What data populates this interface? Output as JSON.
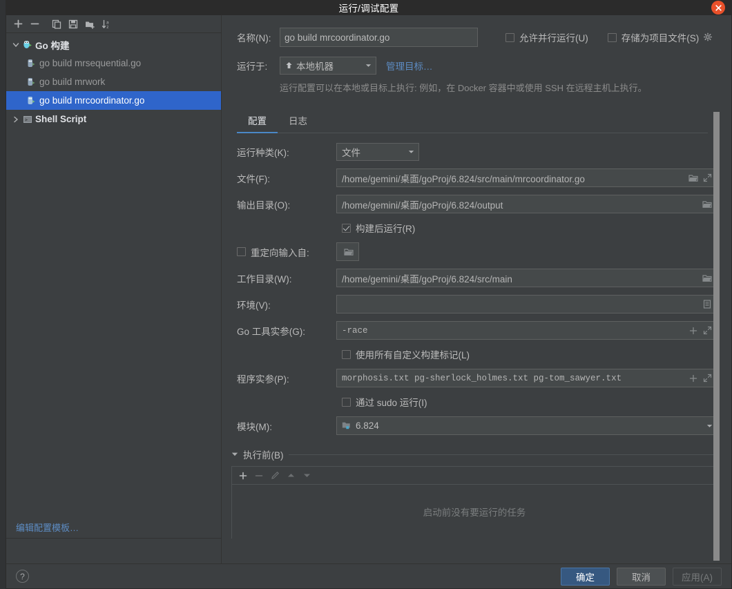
{
  "dialog": {
    "title": "运行/调试配置",
    "close_icon": "close-icon"
  },
  "tree_toolbar": {
    "buttons": [
      {
        "name": "add-configuration",
        "icon": "plus-icon"
      },
      {
        "name": "remove-configuration",
        "icon": "minus-icon"
      },
      {
        "name": "copy-configuration",
        "icon": "copy-icon"
      },
      {
        "name": "save-configuration",
        "icon": "save-icon"
      },
      {
        "name": "move-into-folder",
        "icon": "new-folder-icon"
      },
      {
        "name": "sort-configurations",
        "icon": "sort-alpha-icon"
      }
    ]
  },
  "tree": {
    "items": [
      {
        "label": "Go 构建",
        "type": "group",
        "expanded": true,
        "selected": false,
        "icon": "go-gopher-icon"
      },
      {
        "label": "go build mrsequential.go",
        "type": "child",
        "selected": false,
        "icon": "go-run-icon"
      },
      {
        "label": "go build mrwork",
        "type": "child",
        "selected": false,
        "icon": "go-run-icon"
      },
      {
        "label": "go build mrcoordinator.go",
        "type": "child",
        "selected": true,
        "icon": "go-run-icon"
      },
      {
        "label": "Shell Script",
        "type": "group",
        "expanded": false,
        "selected": false,
        "icon": "shell-script-icon"
      }
    ],
    "edit_templates_link": "编辑配置模板…"
  },
  "header": {
    "name_label": "名称(N):",
    "name_value": "go build mrcoordinator.go",
    "allow_parallel_label": "允许并行运行(U)",
    "allow_parallel_checked": false,
    "store_as_project_file_label": "存储为项目文件(S)",
    "store_as_project_file_checked": false,
    "gear_icon": "gear-icon",
    "run_on_label": "运行于:",
    "run_on_value": "本地机器",
    "manage_targets_link": "管理目标…",
    "hint": "运行配置可以在本地或目标上执行: 例如，在 Docker 容器中或使用 SSH 在远程主机上执行。"
  },
  "tabs": [
    {
      "label": "配置",
      "active": true
    },
    {
      "label": "日志",
      "active": false
    }
  ],
  "form": {
    "run_kind_label": "运行种类(K):",
    "run_kind_value": "文件",
    "file_label": "文件(F):",
    "file_value": "/home/gemini/桌面/goProj/6.824/src/main/mrcoordinator.go",
    "output_dir_label": "输出目录(O):",
    "output_dir_value": "/home/gemini/桌面/goProj/6.824/output",
    "run_after_build_label": "构建后运行(R)",
    "run_after_build_checked": true,
    "redirect_input_label": "重定向输入自:",
    "redirect_input_checked": false,
    "redirect_input_value": "",
    "working_dir_label": "工作目录(W):",
    "working_dir_value": "/home/gemini/桌面/goProj/6.824/src/main",
    "environment_label": "环境(V):",
    "environment_value": "",
    "go_tool_args_label": "Go 工具实参(G):",
    "go_tool_args_value": "-race",
    "use_all_custom_build_tags_label": "使用所有自定义构建标记(L)",
    "use_all_custom_build_tags_checked": false,
    "program_args_label": "程序实参(P):",
    "program_args_value": "morphosis.txt pg-sherlock_holmes.txt pg-tom_sawyer.txt",
    "run_with_sudo_label": "通过 sudo 运行(I)",
    "run_with_sudo_checked": false,
    "module_label": "模块(M):",
    "module_value": "6.824"
  },
  "before_launch": {
    "title": "执行前(B)",
    "expanded": true,
    "toolbar": [
      {
        "name": "add-task",
        "icon": "plus-icon",
        "enabled": true
      },
      {
        "name": "remove-task",
        "icon": "minus-icon",
        "enabled": false
      },
      {
        "name": "edit-task",
        "icon": "pencil-icon",
        "enabled": false
      },
      {
        "name": "move-task-up",
        "icon": "arrow-up-icon",
        "enabled": false
      },
      {
        "name": "move-task-down",
        "icon": "arrow-down-icon",
        "enabled": false
      }
    ],
    "empty_text": "启动前没有要运行的任务"
  },
  "footer": {
    "help_label": "?",
    "ok_label": "确定",
    "cancel_label": "取消",
    "apply_label": "应用(A)"
  },
  "colors": {
    "accent_blue": "#2f65ca",
    "link_blue": "#5d8cc4",
    "close_red": "#e8502a",
    "panel_bg": "#3c3f41",
    "field_bg": "#45494a",
    "titlebar_bg": "#2b2b2b"
  }
}
